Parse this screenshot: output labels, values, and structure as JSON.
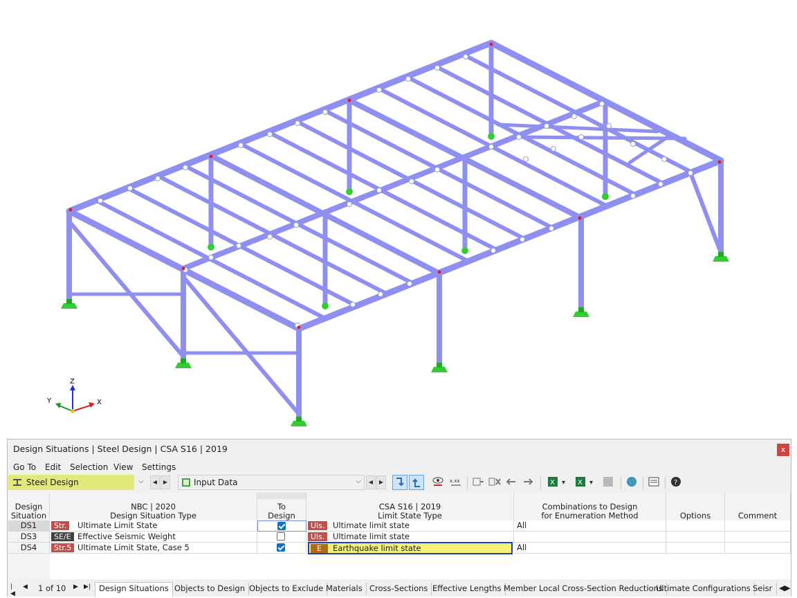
{
  "colors": {
    "member": "#8f8ff2",
    "support": "#2fc72f",
    "module_bg": "#e1e97a",
    "ds1_badge": "#c0504d",
    "ds3_badge": "#404040",
    "ds4_badge": "#c0504d",
    "uls_badge": "#c0504d",
    "e_badge": "#b06a1c",
    "highlight": "#f4f07a",
    "selection": "#1f3fbf"
  },
  "axes": {
    "z": "Z",
    "y": "Y",
    "x": "X"
  },
  "panel": {
    "title": "Design Situations | Steel Design | CSA S16 | 2019",
    "close": "x",
    "menu": [
      "Go To",
      "Edit",
      "Selection",
      "View",
      "Settings"
    ],
    "module": "Steel Design",
    "view": "Input Data"
  },
  "table": {
    "headers": {
      "ds": [
        "Design",
        "Situation"
      ],
      "nbc": [
        "NBC | 2020",
        "Design Situation Type"
      ],
      "to_design": [
        "To",
        "Design"
      ],
      "csa": [
        "CSA S16 | 2019",
        "Limit State Type"
      ],
      "combos": [
        "Combinations to Design",
        "for Enumeration Method"
      ],
      "options": "Options",
      "comment": "Comment"
    },
    "rows": [
      {
        "id": "DS1",
        "badge": "Str.",
        "type": "Ultimate Limit State",
        "checked": true,
        "ls_badge": "Uls.",
        "ls": "Ultimate limit state",
        "combos": "All"
      },
      {
        "id": "DS3",
        "badge": "SE/E",
        "type": "Effective Seismic Weight",
        "checked": false,
        "ls_badge": "Uls.",
        "ls": "Ultimate limit state",
        "combos": ""
      },
      {
        "id": "DS4",
        "badge": "Str.5",
        "type": "Ultimate Limit State, Case 5",
        "checked": true,
        "ls_badge": "E",
        "ls": "Earthquake limit state",
        "combos": "All"
      }
    ]
  },
  "pager": {
    "text": "1 of 10"
  },
  "tabs": [
    "Design Situations",
    "Objects to Design",
    "Objects to Exclude",
    "Materials",
    "Cross-Sections",
    "Effective Lengths",
    "Member Local Cross-Section Reductions",
    "Ultimate Configurations",
    "Seisr"
  ]
}
